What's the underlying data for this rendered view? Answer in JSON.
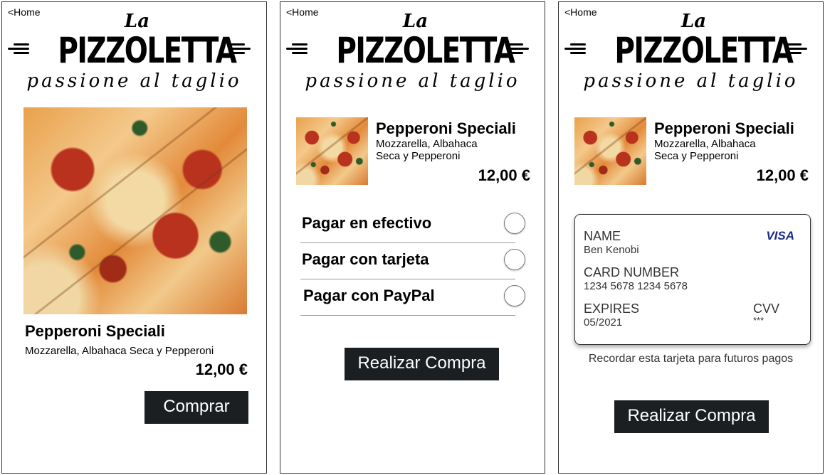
{
  "common": {
    "home_link": "<Home",
    "logo_la": "La",
    "logo_main": "PIZZOLETTA",
    "tagline": "passione al taglio"
  },
  "product": {
    "name": "Pepperoni Speciali",
    "description": "Mozzarella, Albahaca Seca y Pepperoni",
    "description_line1": "Mozzarella, Albahaca",
    "description_line2": "Seca y Pepperoni",
    "price": "12,00 €"
  },
  "screen1": {
    "buy_label": "Comprar"
  },
  "screen2": {
    "payment_options": [
      {
        "label": "Pagar en efectivo",
        "selected": false
      },
      {
        "label": "Pagar con tarjeta",
        "selected": false
      },
      {
        "label": "Pagar con PayPal",
        "selected": false
      }
    ],
    "submit_label": "Realizar Compra"
  },
  "screen3": {
    "card": {
      "name_label": "NAME",
      "name_value": "Ben Kenobi",
      "brand": "VISA",
      "number_label": "CARD NUMBER",
      "number_value": "1234 5678 1234 5678",
      "expires_label": "EXPIRES",
      "expires_value": "05/2021",
      "cvv_label": "CVV",
      "cvv_value": "***"
    },
    "remember_text": "Recordar esta tarjeta para futuros pagos",
    "submit_label": "Realizar Compra"
  },
  "colors": {
    "button_bg": "#1b1f22",
    "visa_blue": "#1a2a8a"
  },
  "icons": {
    "radio": "radio-circle-icon",
    "decor_lines": "speed-lines-icon"
  }
}
